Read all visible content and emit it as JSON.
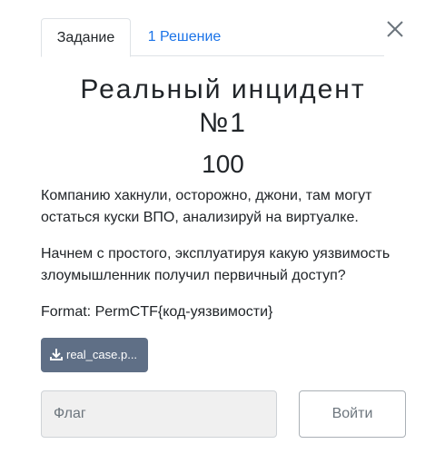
{
  "tabs": {
    "active_label": "Задание",
    "solutions_label": "1 Решение"
  },
  "challenge": {
    "title_line1": "Реальный инцидент",
    "title_line2": "№1",
    "value": "100",
    "description_1": "Компанию хакнули, осторожно, джони, там могут остаться куски ВПО, анализируй на виртуалке.",
    "description_2": "Начнем с простого, эксплуатируя какую уязвимость злоумышленник получил первичный доступ?",
    "description_3": "Format: PermCTF{код-уязвимости}"
  },
  "file": {
    "label": "real_case.p...",
    "icon": "download-icon"
  },
  "form": {
    "flag_placeholder": "Флаг",
    "submit_label": "Войти"
  },
  "icons": {
    "close": "close-icon"
  },
  "colors": {
    "link": "#1a73e8",
    "file_button": "#5f6f86",
    "input_bg": "#f0f0f0"
  }
}
